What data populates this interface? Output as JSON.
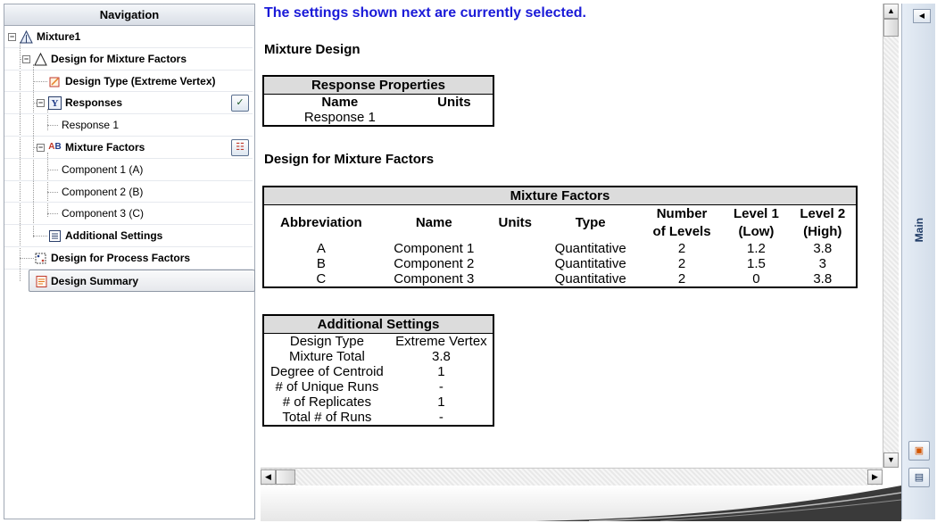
{
  "navigation": {
    "title": "Navigation",
    "nodes": [
      {
        "label": "Mixture1"
      },
      {
        "label": "Design for Mixture Factors"
      },
      {
        "label": "Design Type (Extreme Vertex)"
      },
      {
        "label": "Responses"
      },
      {
        "label": "Response 1"
      },
      {
        "label": "Mixture Factors"
      },
      {
        "label": "Component 1 (A)"
      },
      {
        "label": "Component 2 (B)"
      },
      {
        "label": "Component 3 (C)"
      },
      {
        "label": "Additional Settings"
      },
      {
        "label": "Design for Process Factors"
      },
      {
        "label": "Design Summary"
      }
    ]
  },
  "report": {
    "notice": "The settings shown next are currently selected.",
    "mixture_design_heading": "Mixture Design",
    "response_properties": {
      "caption": "Response Properties",
      "headers": [
        "Name",
        "Units"
      ],
      "rows": [
        [
          "Response 1",
          ""
        ]
      ]
    },
    "design_for_mixture_heading": "Design for Mixture Factors",
    "mixture_factors": {
      "caption": "Mixture Factors",
      "headers": [
        "Abbreviation",
        "Name",
        "Units",
        "Type",
        "Number of Levels",
        "Level 1 (Low)",
        "Level 2 (High)"
      ],
      "header_lines": {
        "number_of_levels": [
          "Number",
          "of Levels"
        ],
        "level1": [
          "Level 1",
          "(Low)"
        ],
        "level2": [
          "Level 2",
          "(High)"
        ]
      },
      "rows": [
        [
          "A",
          "Component 1",
          "",
          "Quantitative",
          "2",
          "1.2",
          "3.8"
        ],
        [
          "B",
          "Component 2",
          "",
          "Quantitative",
          "2",
          "1.5",
          "3"
        ],
        [
          "C",
          "Component 3",
          "",
          "Quantitative",
          "2",
          "0",
          "3.8"
        ]
      ]
    },
    "additional_settings": {
      "caption": "Additional Settings",
      "rows": [
        [
          "Design Type",
          "Extreme Vertex"
        ],
        [
          "Mixture Total",
          "3.8"
        ],
        [
          "Degree of Centroid",
          "1"
        ],
        [
          "# of Unique Runs",
          "-"
        ],
        [
          "# of Replicates",
          "1"
        ],
        [
          "Total # of Runs",
          "-"
        ]
      ]
    }
  },
  "dock": {
    "label": "Main"
  },
  "colors": {
    "notice": "#1a1ad8",
    "caption_bg": "#dcdcdc"
  }
}
